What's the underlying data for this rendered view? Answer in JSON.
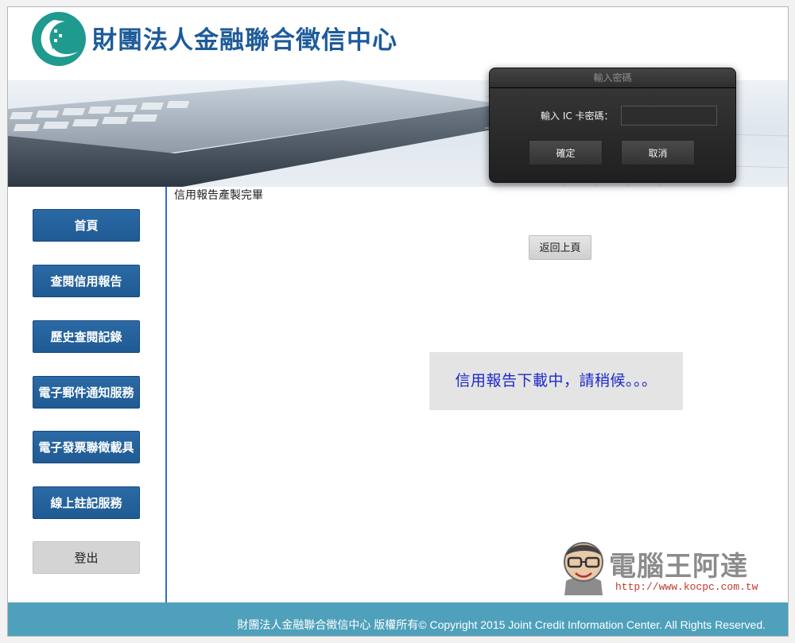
{
  "header": {
    "site_title": "財團法人金融聯合徵信中心"
  },
  "password_dialog": {
    "title": "輸入密碼",
    "label": "輸入 IC 卡密碼：",
    "input_value": "",
    "ok_label": "確定",
    "cancel_label": "取消"
  },
  "sidebar": {
    "items": [
      {
        "label": "首頁"
      },
      {
        "label": "查閱信用報告"
      },
      {
        "label": "歷史查閱記錄"
      },
      {
        "label": "電子郵件通知服務"
      },
      {
        "label": "電子發票聯徵載具"
      },
      {
        "label": "線上註記服務"
      },
      {
        "label": "登出"
      }
    ]
  },
  "main": {
    "status_title": "信用報告產製完畢",
    "back_label": "返回上頁",
    "loading_text": "信用報告下載中，請稍候。。。"
  },
  "watermark": {
    "title": "電腦王阿達",
    "url": "http://www.kocpc.com.tw"
  },
  "footer": {
    "text": "財團法人金融聯合徵信中心 版權所有© Copyright 2015 Joint Credit Information Center. All Rights Reserved."
  },
  "colors": {
    "brand_blue": "#1e5b9a",
    "nav_blue": "#2463a0",
    "footer_teal": "#4ea0bb",
    "loading_text": "#1e28c8"
  }
}
